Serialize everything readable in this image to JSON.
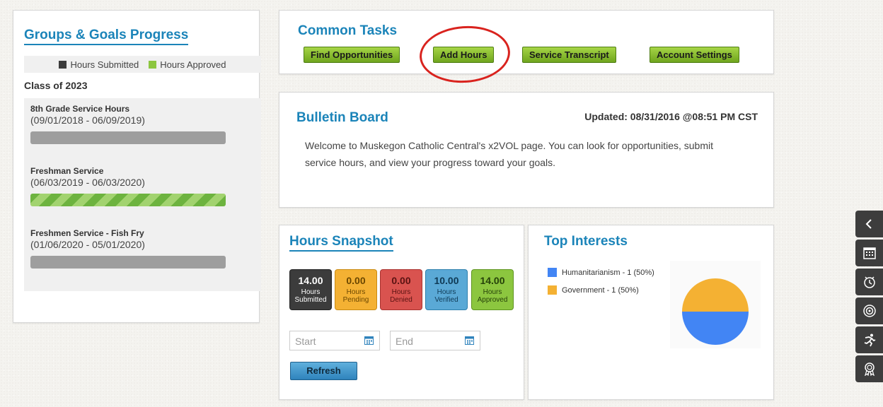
{
  "groups": {
    "title": "Groups & Goals Progress",
    "legend": {
      "submitted": "Hours Submitted",
      "approved": "Hours Approved"
    },
    "class_label": "Class of 2023",
    "goals": [
      {
        "name": "8th Grade Service Hours",
        "dates": "(09/01/2018 - 06/09/2019)",
        "approved_fraction": 0
      },
      {
        "name": "Freshman Service",
        "dates": "(06/03/2019 - 06/03/2020)",
        "approved_fraction": 1
      },
      {
        "name": "Freshmen Service - Fish Fry",
        "dates": "(01/06/2020 - 05/01/2020)",
        "approved_fraction": 0
      }
    ]
  },
  "tasks": {
    "title": "Common Tasks",
    "buttons": [
      "Find Opportunities",
      "Add Hours",
      "Service Transcript",
      "Account Settings"
    ]
  },
  "bulletin": {
    "title": "Bulletin Board",
    "updated": "Updated: 08/31/2016 @08:51 PM CST",
    "text": "Welcome to Muskegon Catholic Central's x2VOL page. You can look for opportunities, submit service hours, and view your progress toward your goals."
  },
  "snapshot": {
    "title": "Hours Snapshot",
    "tiles": [
      {
        "value": "14.00",
        "line1": "Hours",
        "line2": "Submitted",
        "color": "#3c3c3c"
      },
      {
        "value": "0.00",
        "line1": "Hours",
        "line2": "Pending",
        "color": "#f4b133"
      },
      {
        "value": "0.00",
        "line1": "Hours",
        "line2": "Denied",
        "color": "#d9534f"
      },
      {
        "value": "10.00",
        "line1": "Hours",
        "line2": "Verified",
        "color": "#5aa9d6"
      },
      {
        "value": "14.00",
        "line1": "Hours",
        "line2": "Approved",
        "color": "#8cc63f"
      }
    ],
    "start_placeholder": "Start",
    "end_placeholder": "End",
    "refresh": "Refresh"
  },
  "interests": {
    "title": "Top Interests",
    "items": [
      {
        "label": "Humanitarianism -  1 (50%)",
        "color": "#4285f4",
        "share": 50
      },
      {
        "label": "Government -  1 (50%)",
        "color": "#f4b133",
        "share": 50
      }
    ]
  },
  "colors": {
    "accent": "#1b84b9",
    "submitted": "#3c3c3c",
    "approved": "#8cc63f"
  },
  "toolbar": [
    "chevron-left-icon",
    "calendar-icon",
    "clock-icon",
    "target-icon",
    "runner-icon",
    "award-icon"
  ]
}
